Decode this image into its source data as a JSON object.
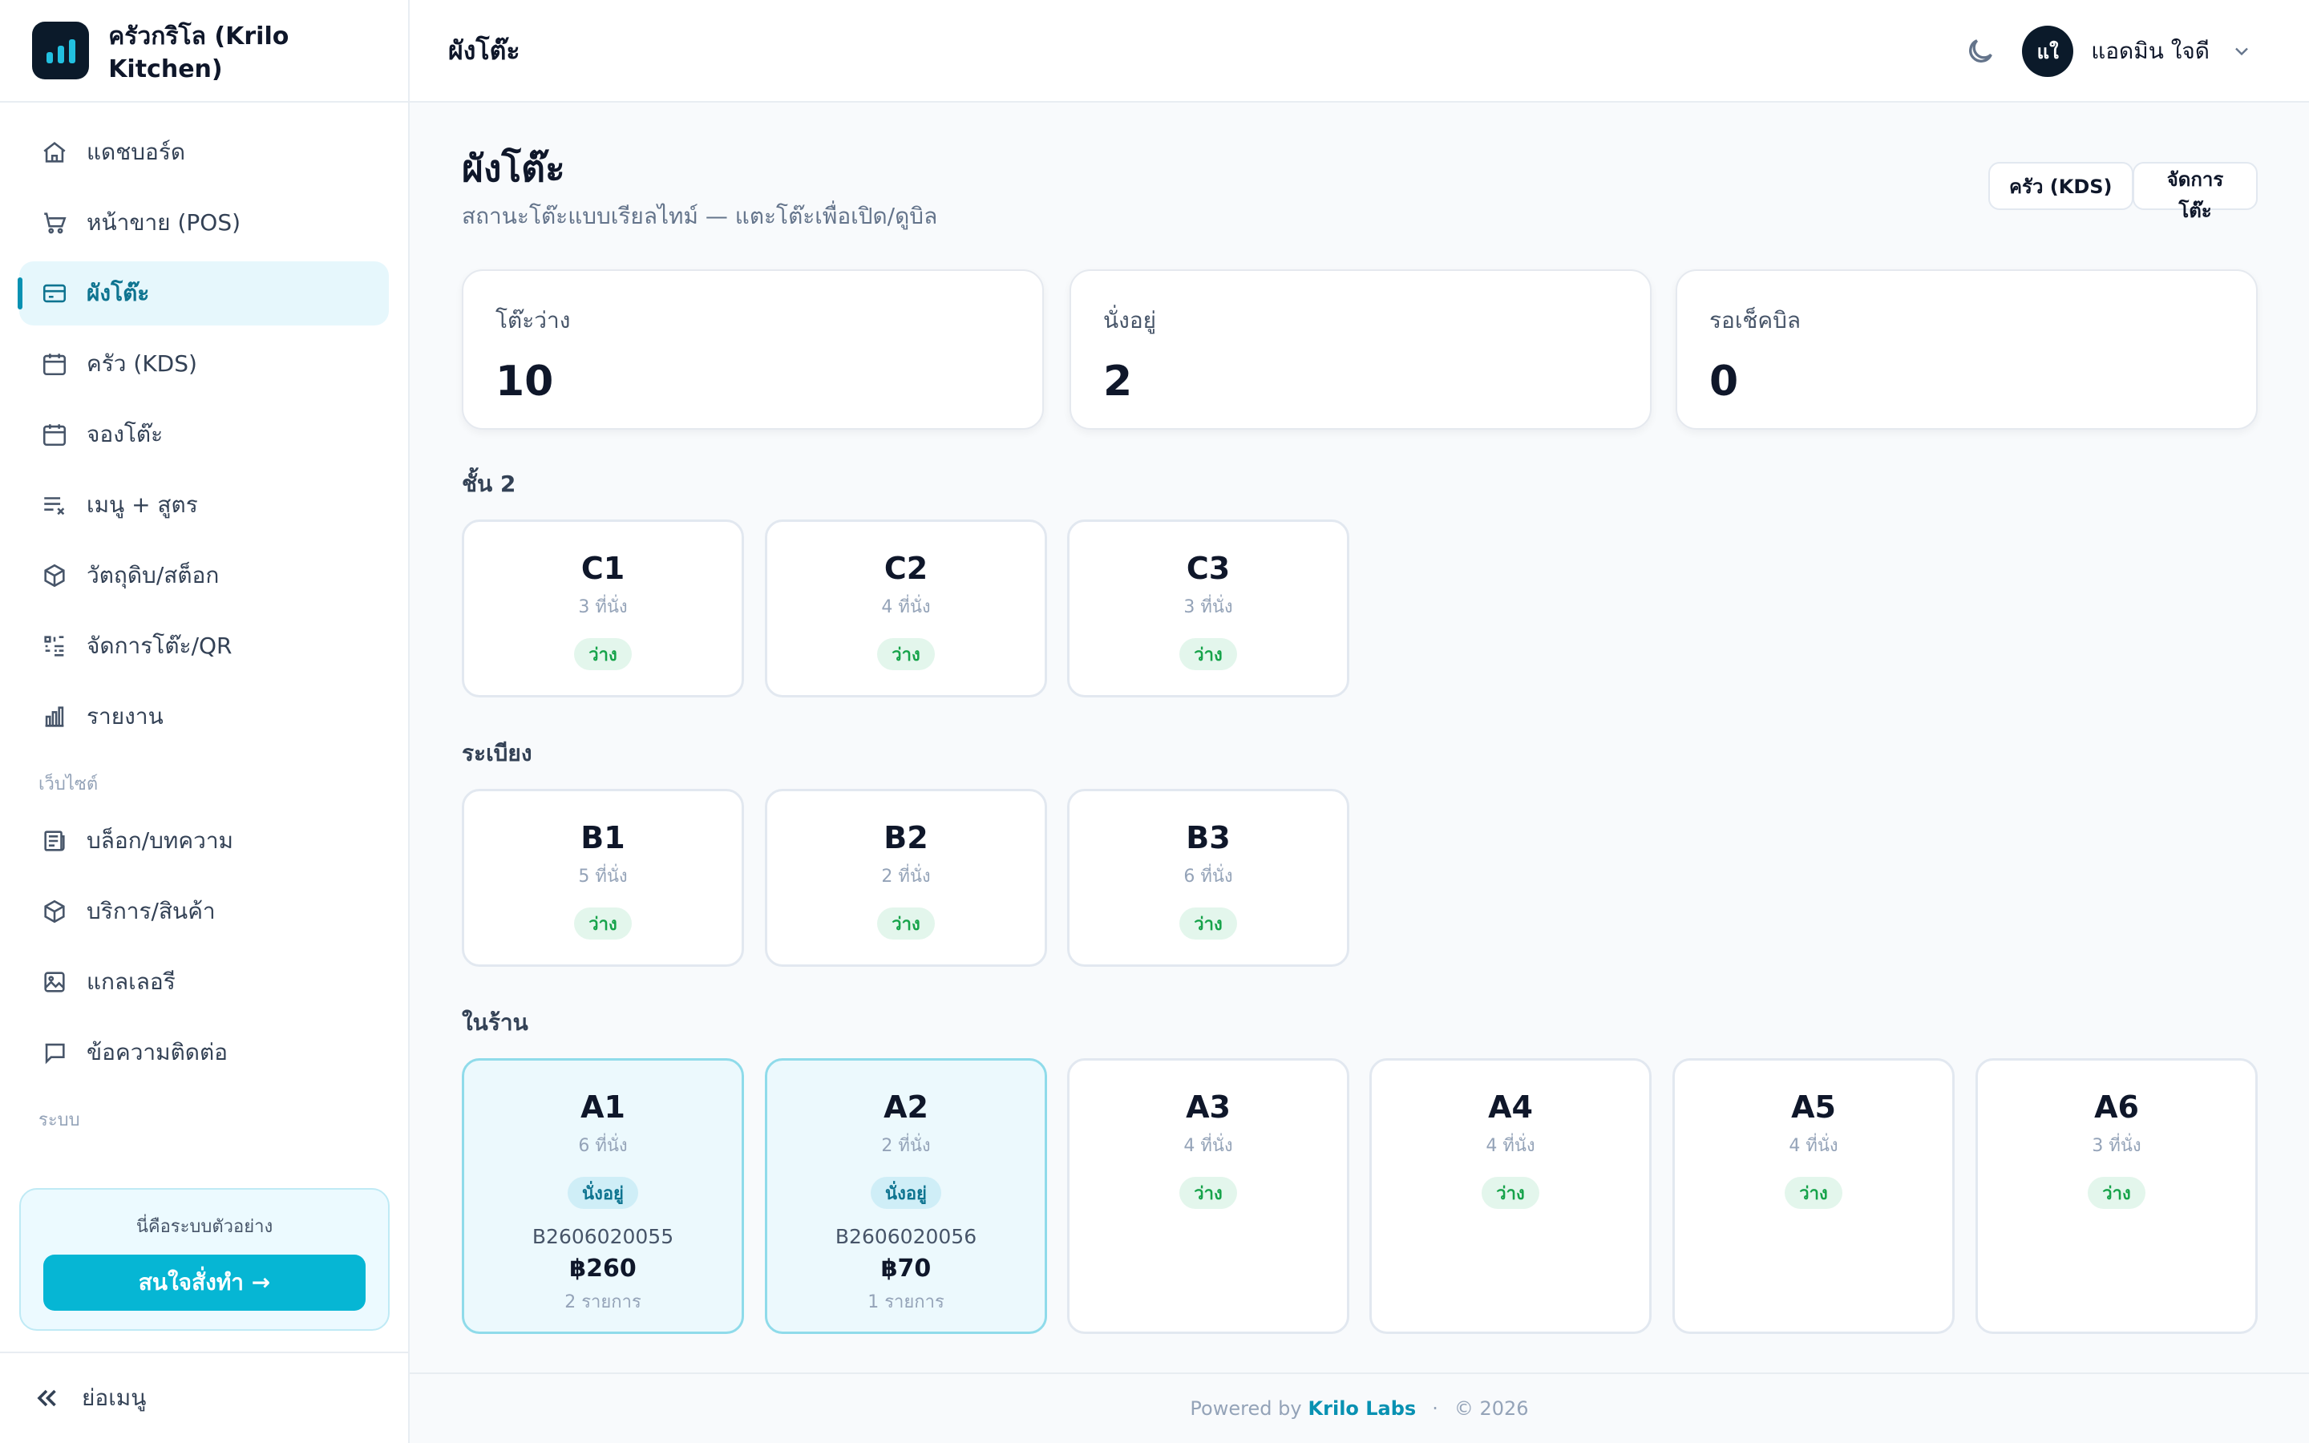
{
  "brand": {
    "name": "ครัวกริโล (Krilo Kitchen)"
  },
  "sidebar": {
    "items": [
      {
        "label": "แดชบอร์ด",
        "icon": "home-icon"
      },
      {
        "label": "หน้าขาย (POS)",
        "icon": "cart-icon"
      },
      {
        "label": "ผังโต๊ะ",
        "icon": "card-icon"
      },
      {
        "label": "ครัว (KDS)",
        "icon": "calendar-icon"
      },
      {
        "label": "จองโต๊ะ",
        "icon": "calendar-icon"
      },
      {
        "label": "เมนู + สูตร",
        "icon": "list-x-icon"
      },
      {
        "label": "วัตถุดิบ/สต็อก",
        "icon": "box-icon"
      },
      {
        "label": "จัดการโต๊ะ/QR",
        "icon": "qr-icon"
      },
      {
        "label": "รายงาน",
        "icon": "bar-chart-icon"
      }
    ],
    "section_website": "เว็บไซต์",
    "website_items": [
      {
        "label": "บล็อก/บทความ",
        "icon": "newspaper-icon"
      },
      {
        "label": "บริการ/สินค้า",
        "icon": "box-icon"
      },
      {
        "label": "แกลเลอรี",
        "icon": "image-icon"
      },
      {
        "label": "ข้อความติดต่อ",
        "icon": "message-icon"
      }
    ],
    "section_system": "ระบบ",
    "promo_text": "นี่คือระบบตัวอย่าง",
    "promo_button": "สนใจสั่งทำ →",
    "collapse_label": "ย่อเมนู"
  },
  "topbar": {
    "title": "ผังโต๊ะ",
    "avatar_initials": "แใ",
    "user_name": "แอดมิน ใจดี"
  },
  "page": {
    "title": "ผังโต๊ะ",
    "subtitle": "สถานะโต๊ะแบบเรียลไทม์ — แตะโต๊ะเพื่อเปิด/ดูบิล",
    "btn_kds": "ครัว (KDS)",
    "btn_manage": "จัดการโต๊ะ"
  },
  "stats": [
    {
      "label": "โต๊ะว่าง",
      "value": "10"
    },
    {
      "label": "นั่งอยู่",
      "value": "2"
    },
    {
      "label": "รอเช็คบิล",
      "value": "0"
    }
  ],
  "groups": [
    {
      "label": "ชั้น 2",
      "tables": [
        {
          "name": "C1",
          "seats": "3 ที่นั่ง",
          "status": "ว่าง"
        },
        {
          "name": "C2",
          "seats": "4 ที่นั่ง",
          "status": "ว่าง"
        },
        {
          "name": "C3",
          "seats": "3 ที่นั่ง",
          "status": "ว่าง"
        }
      ]
    },
    {
      "label": "ระเบียง",
      "tables": [
        {
          "name": "B1",
          "seats": "5 ที่นั่ง",
          "status": "ว่าง"
        },
        {
          "name": "B2",
          "seats": "2 ที่นั่ง",
          "status": "ว่าง"
        },
        {
          "name": "B3",
          "seats": "6 ที่นั่ง",
          "status": "ว่าง"
        }
      ]
    },
    {
      "label": "ในร้าน",
      "tables": [
        {
          "name": "A1",
          "seats": "6 ที่นั่ง",
          "status": "นั่งอยู่",
          "bill": "B2606020055",
          "amount": "฿260",
          "items": "2 รายการ"
        },
        {
          "name": "A2",
          "seats": "2 ที่นั่ง",
          "status": "นั่งอยู่",
          "bill": "B2606020056",
          "amount": "฿70",
          "items": "1 รายการ"
        },
        {
          "name": "A3",
          "seats": "4 ที่นั่ง",
          "status": "ว่าง"
        },
        {
          "name": "A4",
          "seats": "4 ที่นั่ง",
          "status": "ว่าง"
        },
        {
          "name": "A5",
          "seats": "4 ที่นั่ง",
          "status": "ว่าง"
        },
        {
          "name": "A6",
          "seats": "3 ที่นั่ง",
          "status": "ว่าง"
        }
      ]
    }
  ],
  "footer": {
    "powered": "Powered by",
    "brand": "Krilo Labs",
    "copyright": "© 2026"
  },
  "colors": {
    "accent": "#06b6d4",
    "free": "#16a34a",
    "busy": "#0e7490"
  }
}
